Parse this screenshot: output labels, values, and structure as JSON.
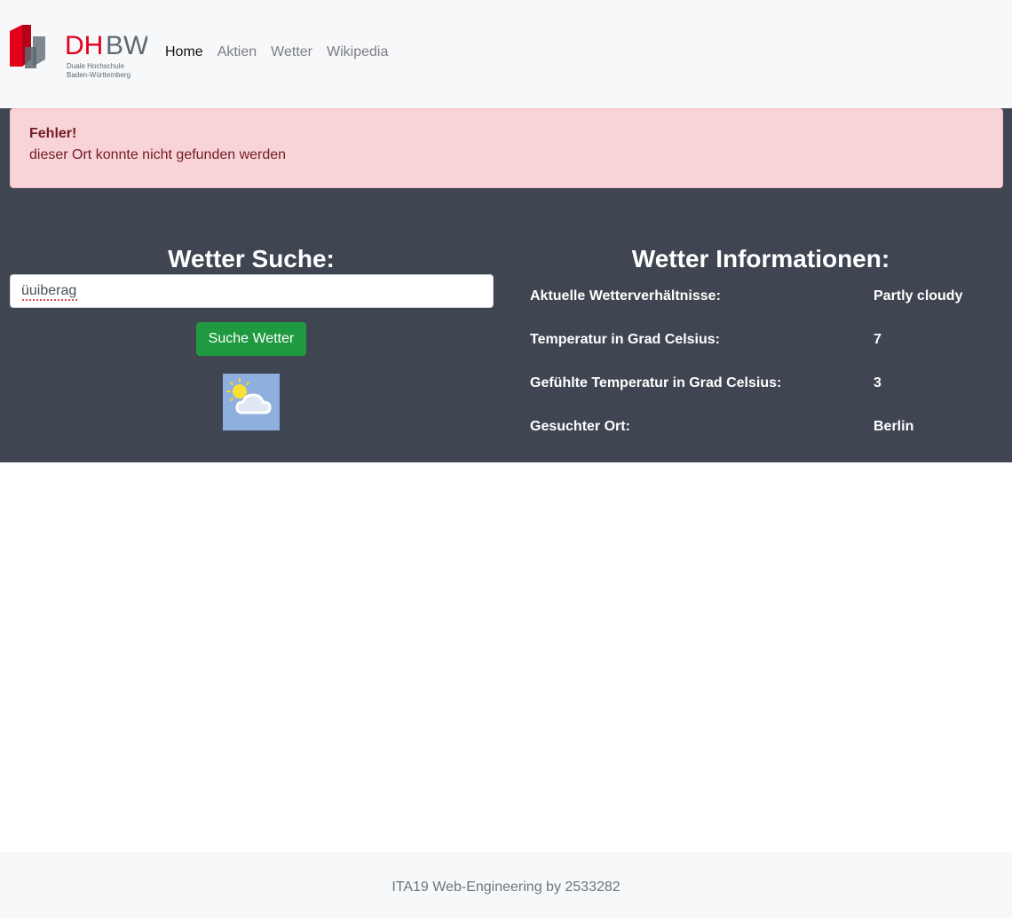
{
  "navbar": {
    "logo": {
      "brand": "DHBW",
      "line1": "Duale Hochschule",
      "line2": "Baden-Württemberg",
      "colors": {
        "red": "#e2001a",
        "gray": "#5c6971"
      }
    },
    "links": [
      {
        "label": "Home",
        "active": true
      },
      {
        "label": "Aktien",
        "active": false
      },
      {
        "label": "Wetter",
        "active": false
      },
      {
        "label": "Wikipedia",
        "active": false
      }
    ]
  },
  "alert": {
    "title": "Fehler!",
    "message": "dieser Ort konnte nicht gefunden werden"
  },
  "search": {
    "heading": "Wetter Suche:",
    "input_value": "üuiberag",
    "button_label": "Suche Wetter",
    "weather_icon": "partly-cloudy-icon"
  },
  "info": {
    "heading": "Wetter Informationen:",
    "rows": [
      {
        "label": "Aktuelle Wetterverhältnisse:",
        "value": "Partly cloudy"
      },
      {
        "label": "Temperatur in Grad Celsius:",
        "value": "7"
      },
      {
        "label": "Gefühlte Temperatur in Grad Celsius:",
        "value": "3"
      },
      {
        "label": "Gesuchter Ort:",
        "value": "Berlin"
      }
    ]
  },
  "footer": {
    "text": "ITA19 Web-Engineering by 2533282"
  },
  "colors": {
    "navbar_bg": "#f7f8fa",
    "main_bg": "#3f4551",
    "alert_bg": "#f8d3d7",
    "alert_text": "#721c24",
    "button_bg": "#1f9a40"
  }
}
